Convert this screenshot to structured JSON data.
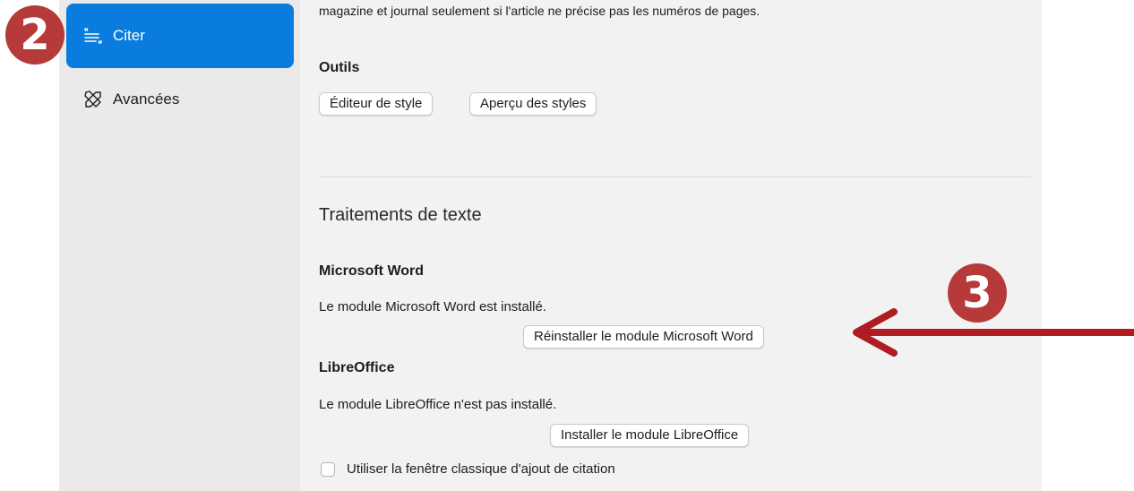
{
  "sidebar": {
    "items": [
      {
        "label": "Citer",
        "icon": "quote-lines-icon",
        "active": true
      },
      {
        "label": "Avancées",
        "icon": "tools-icon",
        "active": false
      }
    ]
  },
  "content": {
    "intro_text": "magazine et journal seulement si l'article ne précise pas les numéros de pages.",
    "tools": {
      "heading": "Outils",
      "style_editor_button": "Éditeur de style",
      "style_preview_button": "Aperçu des styles"
    },
    "word_processors": {
      "title": "Traitements de texte",
      "word": {
        "heading": "Microsoft Word",
        "status": "Le module Microsoft Word est installé.",
        "button": "Réinstaller le module Microsoft Word"
      },
      "libreoffice": {
        "heading": "LibreOffice",
        "status": "Le module LibreOffice n'est pas installé.",
        "button": "Installer le module LibreOffice"
      },
      "classic_dialog": {
        "label": "Utiliser la fenêtre classique d'ajout de citation",
        "checked": false
      }
    }
  },
  "annotations": {
    "badge_2": "2",
    "badge_3": "3",
    "color": "#b73a3a",
    "arrow_color": "#b01c22"
  },
  "colors": {
    "accent": "#0a7cdd",
    "sidebar_bg": "#eaeaea",
    "content_bg": "#f2f2f2"
  }
}
